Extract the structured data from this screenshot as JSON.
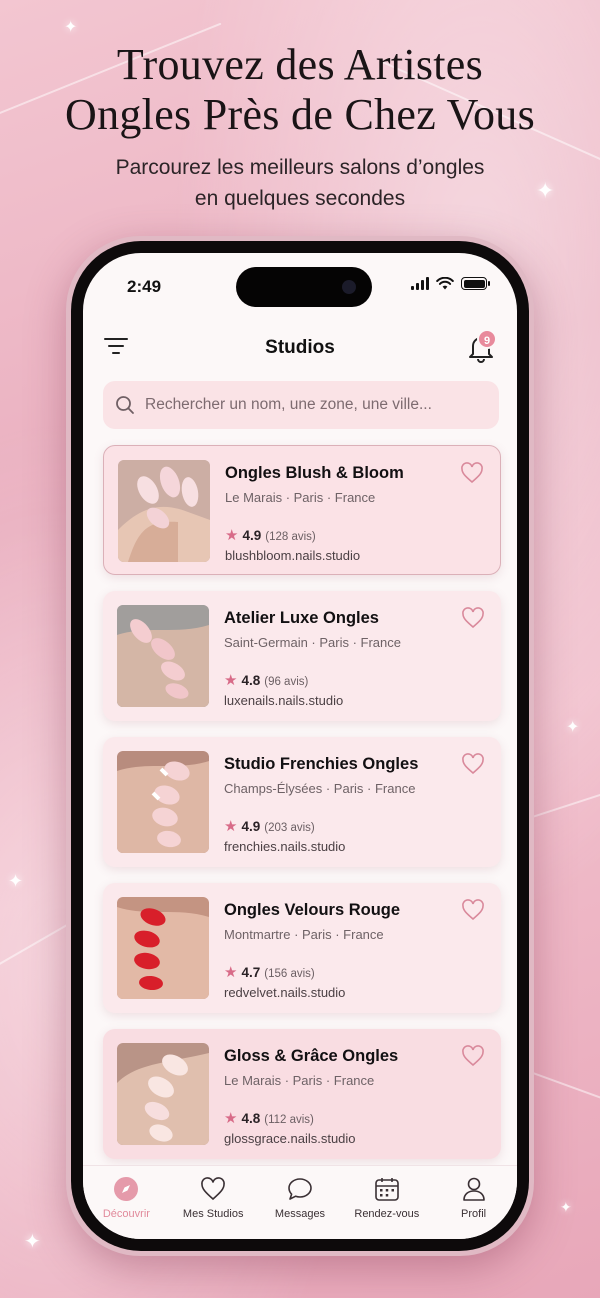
{
  "hero": {
    "title_line1": "Trouvez des Artistes",
    "title_line2": "Ongles Près de Chez Vous",
    "subtitle_line1": "Parcourez les meilleurs salons d’ongles",
    "subtitle_line2": "en quelques secondes"
  },
  "status_bar": {
    "time": "2:49"
  },
  "nav": {
    "title": "Studios",
    "notification_count": "9",
    "icons": [
      "filter-icon",
      "bell-icon"
    ]
  },
  "search": {
    "placeholder": "Rechercher un nom, une zone, une ville..."
  },
  "studios": [
    {
      "name": "Ongles Blush & Bloom",
      "location": "Le Marais · Paris · France",
      "rating": "4.9",
      "reviews": "(128 avis)",
      "website": "blushbloom.nails.studio"
    },
    {
      "name": "Atelier Luxe Ongles",
      "location": "Saint-Germain · Paris · France",
      "rating": "4.8",
      "reviews": "(96 avis)",
      "website": "luxenails.nails.studio"
    },
    {
      "name": "Studio Frenchies Ongles",
      "location": "Champs-Élysées · Paris · France",
      "rating": "4.9",
      "reviews": "(203 avis)",
      "website": "frenchies.nails.studio"
    },
    {
      "name": "Ongles Velours Rouge",
      "location": "Montmartre · Paris · France",
      "rating": "4.7",
      "reviews": "(156 avis)",
      "website": "redvelvet.nails.studio"
    },
    {
      "name": "Gloss & Grâce Ongles",
      "location": "Le Marais · Paris · France",
      "rating": "4.8",
      "reviews": "(112 avis)",
      "website": "glossgrace.nails.studio"
    }
  ],
  "tabs": [
    {
      "label": "Découvrir",
      "icon": "compass-icon",
      "active": true
    },
    {
      "label": "Mes Studios",
      "icon": "heart-icon",
      "active": false
    },
    {
      "label": "Messages",
      "icon": "chat-icon",
      "active": false
    },
    {
      "label": "Rendez-vous",
      "icon": "calendar-icon",
      "active": false
    },
    {
      "label": "Profil",
      "icon": "person-icon",
      "active": false
    }
  ],
  "colors": {
    "accent": "#e18a9b",
    "card_bg": "#fbe9ec",
    "star": "#d86b88",
    "background": "#eeb6c5"
  }
}
